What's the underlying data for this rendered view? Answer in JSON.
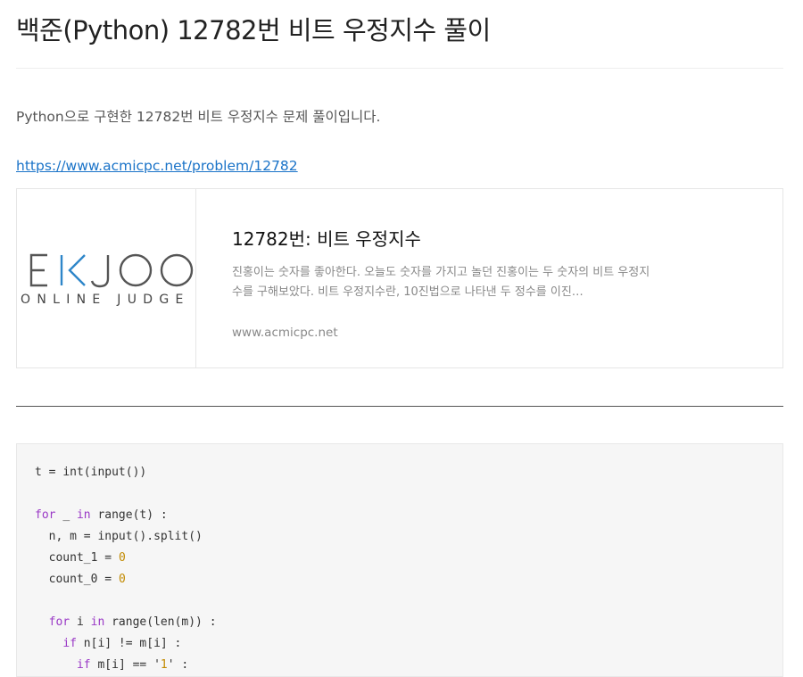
{
  "page": {
    "title": "백준(Python) 12782번 비트 우정지수 풀이",
    "intro": "Python으로 구현한 12782번 비트 우정지수 문제 풀이입니다.",
    "link": "https://www.acmicpc.net/problem/12782"
  },
  "card": {
    "logo_main": "EKJOO",
    "logo_sub": "ONLINE JUDGE",
    "title": "12782번: 비트 우정지수",
    "description": "진홍이는 숫자를 좋아한다. 오늘도 숫자를 가지고 놀던 진홍이는 두 숫자의 비트 우정지수를 구해보았다. 비트 우정지수란, 10진법으로 나타낸 두 정수를 이진…",
    "domain": "www.acmicpc.net"
  },
  "code": {
    "lines": [
      "t = int(input())",
      "",
      "for _ in range(t) :",
      "  n, m = input().split()",
      "  count_1 = 0",
      "  count_0 = 0",
      "",
      "  for i in range(len(m)) :",
      "    if n[i] != m[i] :",
      "      if m[i] == '1' :"
    ]
  },
  "colors": {
    "link": "#1a73c8",
    "keyword": "#9a39c6",
    "number": "#c28a00",
    "logo_accent": "#2e86c9"
  }
}
